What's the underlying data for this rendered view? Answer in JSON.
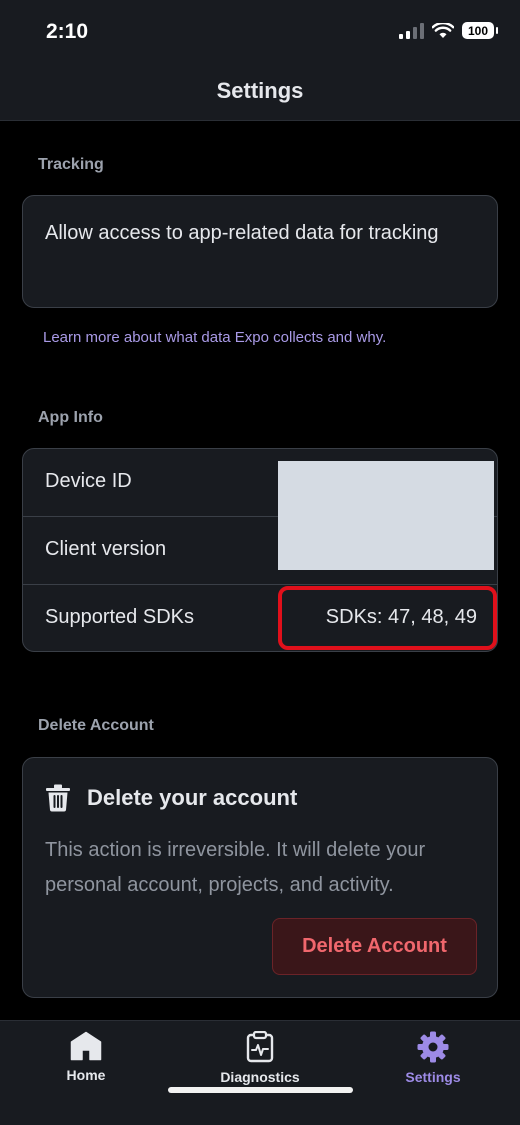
{
  "status_bar": {
    "time": "2:10",
    "battery": "100"
  },
  "header": {
    "title": "Settings"
  },
  "tracking": {
    "section_title": "Tracking",
    "toggle_label": "Allow access to app-related data for tracking",
    "learn_more_link": "Learn more about what data Expo collects and why."
  },
  "app_info": {
    "section_title": "App Info",
    "rows": [
      {
        "label": "Device ID",
        "value": ""
      },
      {
        "label": "Client version",
        "value": ""
      },
      {
        "label": "Supported SDKs",
        "value": "SDKs: 47, 48, 49"
      }
    ]
  },
  "delete_account": {
    "section_title": "Delete Account",
    "title": "Delete your account",
    "description": "This action is irreversible. It will delete your personal account, projects, and activity.",
    "button_label": "Delete Account"
  },
  "tab_bar": {
    "items": [
      {
        "label": "Home",
        "icon": "home-icon",
        "active": false
      },
      {
        "label": "Diagnostics",
        "icon": "clipboard-pulse-icon",
        "active": false
      },
      {
        "label": "Settings",
        "icon": "gear-icon",
        "active": true
      }
    ]
  },
  "colors": {
    "accent": "#9d8be6",
    "danger": "#f0676d",
    "highlight_box": "#e0101b",
    "redaction": "#d5dbe3"
  }
}
